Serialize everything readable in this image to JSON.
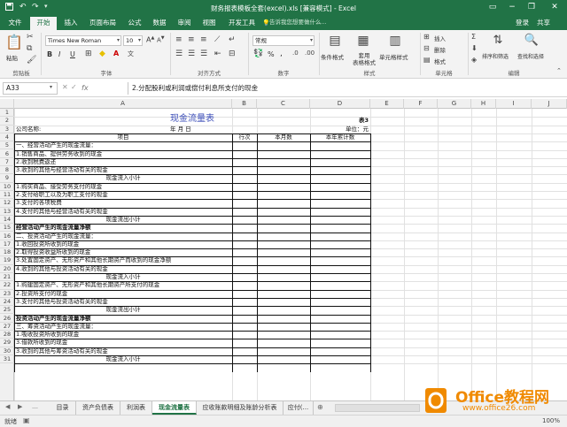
{
  "titlebar": {
    "title": "财务报表模板全套(excel).xls  [兼容模式] - Excel",
    "save_icon": "save-icon",
    "undo_icon": "undo-icon",
    "redo_icon": "redo-icon"
  },
  "tabs": [
    "文件",
    "开始",
    "插入",
    "页面布局",
    "公式",
    "数据",
    "审阅",
    "视图",
    "开发工具"
  ],
  "active_tab": 1,
  "tellme": "告诉我您想要做什么...",
  "login": "登录",
  "share": "共享",
  "ribbon": {
    "paste": "粘贴",
    "clipboard": "剪贴板",
    "font_name": "Times New Roman",
    "font_size": "10",
    "font": "字体",
    "bold": "B",
    "italic": "I",
    "underline": "U",
    "alignment": "对齐方式",
    "number_format": "常规",
    "number": "数字",
    "cond_format": "条件格式",
    "table_format": "套用\n表格格式",
    "cell_style": "单元格样式",
    "styles": "样式",
    "insert": "插入",
    "delete": "删除",
    "format": "格式",
    "cells": "单元格",
    "sort": "排序和筛选",
    "find": "查找和选择",
    "editing": "编辑",
    "percent": "%",
    "comma": ","
  },
  "formula": {
    "namebox": "A33",
    "fx": "fx",
    "content": "2.分配股利或利润或偿付利息所支付的现金"
  },
  "columns": [
    "A",
    "B",
    "C",
    "D",
    "E",
    "F",
    "G",
    "H",
    "I",
    "J"
  ],
  "sheet": {
    "title": "现金流量表",
    "table_no": "表3",
    "company": "公司名称:",
    "date": "年    月    日",
    "unit": "单位：元",
    "h_item": "项目",
    "h_row": "行次",
    "h_month": "本月数",
    "h_year": "本年累计数",
    "rows": [
      {
        "n": "1",
        "t": "",
        "type": "title"
      },
      {
        "n": "2",
        "t": "",
        "type": "tno"
      },
      {
        "n": "3",
        "t": "",
        "type": "meta"
      },
      {
        "n": "4",
        "t": "",
        "type": "head"
      },
      {
        "n": "5",
        "t": "一、经营活动产生的现金流量：",
        "type": "l"
      },
      {
        "n": "6",
        "t": "1.销售商品、提供劳务收到的现金",
        "type": "l"
      },
      {
        "n": "7",
        "t": "2.收到税费返还",
        "type": "l"
      },
      {
        "n": "8",
        "t": "3.收到的其他与经营活动有关的现金",
        "type": "l"
      },
      {
        "n": "9",
        "t": "现金流入小计",
        "type": "c"
      },
      {
        "n": "10",
        "t": "1.购买商品、接受劳务支付的现金",
        "type": "l"
      },
      {
        "n": "11",
        "t": "2.支付给职工以及为职工支付的现金",
        "type": "l"
      },
      {
        "n": "12",
        "t": "3.支付的各项税费",
        "type": "l"
      },
      {
        "n": "13",
        "t": "4.支付的其他与经营活动有关的现金",
        "type": "l"
      },
      {
        "n": "14",
        "t": "现金流出小计",
        "type": "c"
      },
      {
        "n": "15",
        "t": "经营活动产生的现金流量净额",
        "type": "b"
      },
      {
        "n": "16",
        "t": "二、投资活动产生的现金流量：",
        "type": "l"
      },
      {
        "n": "17",
        "t": "1.收回投资所收到的现金",
        "type": "l"
      },
      {
        "n": "18",
        "t": "2.取得投资收益所收到的现金",
        "type": "l"
      },
      {
        "n": "19",
        "t": "3.处置固定资产、无形资产和其他长期资产而收到的现金净额",
        "type": "l"
      },
      {
        "n": "20",
        "t": "4.收到的其他与投资活动有关的现金",
        "type": "l"
      },
      {
        "n": "21",
        "t": "现金流入小计",
        "type": "c"
      },
      {
        "n": "22",
        "t": "1.购建固定资产、无形资产和其他长期资产所支付的现金",
        "type": "l"
      },
      {
        "n": "23",
        "t": "2.投资所支付的现金",
        "type": "l"
      },
      {
        "n": "24",
        "t": "3.支付的其他与投资活动有关的现金",
        "type": "l"
      },
      {
        "n": "25",
        "t": "现金流出小计",
        "type": "c"
      },
      {
        "n": "26",
        "t": "投资活动产生的现金流量净额",
        "type": "b"
      },
      {
        "n": "27",
        "t": "三、筹资活动产生的现金流量：",
        "type": "l"
      },
      {
        "n": "28",
        "t": "1.吸收投资所收到的现金",
        "type": "l"
      },
      {
        "n": "29",
        "t": "3.借款所收到的现金",
        "type": "l"
      },
      {
        "n": "30",
        "t": "3.收到的其他与筹资活动有关的现金",
        "type": "l"
      },
      {
        "n": "31",
        "t": "现金流入小计",
        "type": "c"
      }
    ]
  },
  "sheettabs": [
    "目录",
    "资产负债表",
    "利润表",
    "现金流量表",
    "应收账款明细及账龄分析表",
    "应付(..."
  ],
  "active_sheet": 3,
  "status": {
    "ready": "就绪",
    "zoom": "100%"
  },
  "watermark": {
    "brand": "Office教程网",
    "url": "www.office26.com"
  },
  "colors": {
    "excel_green": "#217346",
    "title_blue": "#3b4db8",
    "watermark_orange": "#f08a00"
  }
}
